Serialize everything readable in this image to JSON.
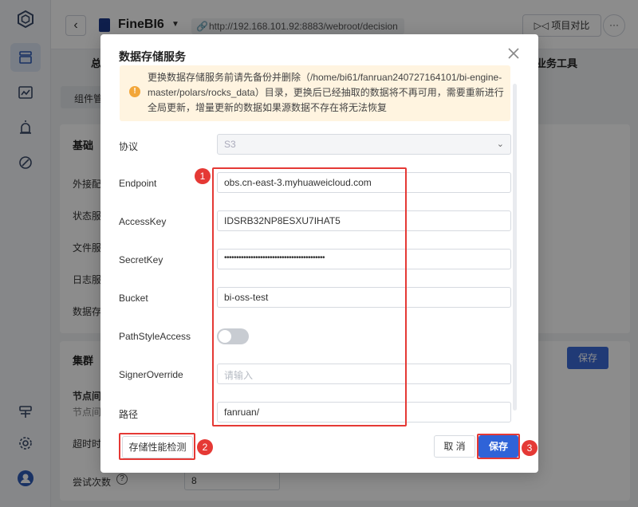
{
  "header": {
    "app_name": "FineBI6",
    "url": "http://192.168.101.92:8883/webroot/decision",
    "compare_label": "项目对比",
    "more_label": "···",
    "tab_left_partial": "总",
    "tab_right_partial": "业务工具"
  },
  "background": {
    "component_tab": "组件管",
    "card1_title": "基础",
    "rows": [
      "外接配",
      "状态服",
      "文件服",
      "日志服",
      "数据存"
    ],
    "card2_title": "集群",
    "node_label": "节点间",
    "node_sub": "节点间",
    "timeout_label": "超时时",
    "retry_label": "尝试次数",
    "retry_value": "8",
    "save_label": "保存"
  },
  "modal": {
    "title": "数据存储服务",
    "alert": "更换数据存储服务前请先备份并删除（/home/bi61/fanruan240727164101/bi-engine-master/polars/rocks_data）目录，更换后已经抽取的数据将不再可用，需要重新进行全局更新，增量更新的数据如果源数据不存在将无法恢复",
    "fields": {
      "protocol_label": "协议",
      "protocol_value": "S3",
      "endpoint_label": "Endpoint",
      "endpoint_value": "obs.cn-east-3.myhuaweicloud.com",
      "accesskey_label": "AccessKey",
      "accesskey_value": "IDSRB32NP8ESXU7IHAT5",
      "secretkey_label": "SecretKey",
      "secretkey_value": "••••••••••••••••••••••••••••••••••••••••••",
      "bucket_label": "Bucket",
      "bucket_value": "bi-oss-test",
      "pathstyle_label": "PathStyleAccess",
      "pathstyle_on": false,
      "signer_label": "SignerOverride",
      "signer_placeholder": "请输入",
      "path_label": "路径",
      "path_value": "fanruan/"
    },
    "buttons": {
      "perf_check": "存储性能检测",
      "cancel": "取 消",
      "save": "保存"
    },
    "callouts": [
      "1",
      "2",
      "3"
    ]
  },
  "colors": {
    "primary": "#2f63d8",
    "callout": "#e53935",
    "alert_bg": "#fff4e0",
    "alert_icon": "#f2a63a"
  }
}
